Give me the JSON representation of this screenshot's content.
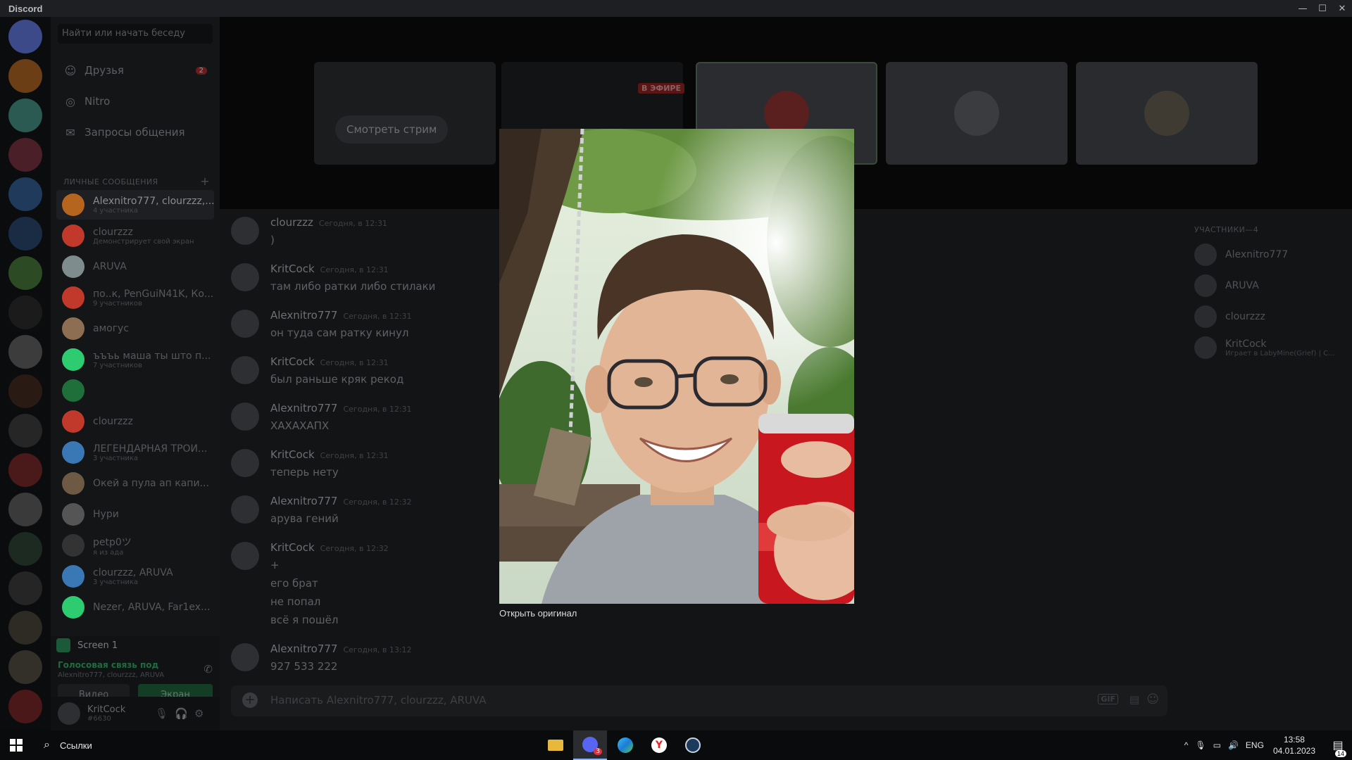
{
  "window": {
    "title": "Discord",
    "controls": [
      "—",
      "☐",
      "✕"
    ]
  },
  "dm_panel": {
    "search_placeholder": "Найти или начать беседу",
    "nav": [
      {
        "label": "Друзья",
        "icon": "friends-icon",
        "count": "2"
      },
      {
        "label": "Nitro",
        "icon": "nitro-icon"
      },
      {
        "label": "Запросы общения",
        "icon": "mail-icon"
      }
    ],
    "section_title": "ЛИЧНЫЕ СООБЩЕНИЯ",
    "section_add": "+",
    "dms": [
      {
        "name": "Alexnitro777, clourzzz,...",
        "sub": "4 участника",
        "color": "#b5651d",
        "active": true
      },
      {
        "name": "clourzzz",
        "sub": "Демонстрирует свой экран",
        "color": "#c0392b"
      },
      {
        "name": "ARUVA",
        "sub": "",
        "color": "#7f8c8d"
      },
      {
        "name": "по..к, PenGuiN41K, Ко...",
        "sub": "9 участников",
        "color": "#c0392b"
      },
      {
        "name": "амогус",
        "sub": "",
        "color": "#8e6e53"
      },
      {
        "name": "ъъъь маша ты што п...",
        "sub": "7 участников",
        "color": "#2ecc71"
      },
      {
        "name": "",
        "sub": "",
        "color": "#1f6f3a"
      },
      {
        "name": "clourzzz",
        "sub": "",
        "color": "#c0392b"
      },
      {
        "name": "ЛЕГЕНДАРНАЯ ТРОИ...",
        "sub": "3 участника",
        "color": "#3a78b5"
      },
      {
        "name": "Окей а пула ап капи...",
        "sub": "",
        "color": "#6e5a44"
      },
      {
        "name": "Нури",
        "sub": "",
        "color": "#555"
      },
      {
        "name": "petp0ツ",
        "sub": "я из ада",
        "color": "#333"
      },
      {
        "name": "clourzzz, ARUVA",
        "sub": "3 участника",
        "color": "#3a78b5"
      },
      {
        "name": "Nezer, ARUVA, Far1ex...",
        "sub": "",
        "color": "#2ecc71"
      }
    ],
    "screen_share": "Screen 1",
    "voice_status": "Голосовая связь под",
    "voice_members": "Alexnitro777, clourzzz, ARUVA",
    "video_label": "Видео",
    "screen_label": "Экран",
    "user_name": "KritCock",
    "user_tag": "#6630"
  },
  "stream": {
    "watch_label": "Смотреть стрим",
    "live_label": "В ЭФИРЕ"
  },
  "messages": [
    {
      "author": "clourzzz",
      "time": "Сегодня, в 12:31",
      "lines": [
        ")"
      ]
    },
    {
      "author": "KritCock",
      "time": "Сегодня, в 12:31",
      "lines": [
        "там либо ратки либо стилаки"
      ]
    },
    {
      "author": "Alexnitro777",
      "time": "Сегодня, в 12:31",
      "lines": [
        "он туда сам ратку кинул"
      ]
    },
    {
      "author": "KritCock",
      "time": "Сегодня, в 12:31",
      "lines": [
        "был раньше кряк рекод"
      ]
    },
    {
      "author": "Alexnitro777",
      "time": "Сегодня, в 12:31",
      "lines": [
        "ХАХАХАПХ"
      ]
    },
    {
      "author": "KritCock",
      "time": "Сегодня, в 12:31",
      "lines": [
        "теперь нету"
      ]
    },
    {
      "author": "Alexnitro777",
      "time": "Сегодня, в 12:32",
      "lines": [
        "арува гений"
      ]
    },
    {
      "author": "KritCock",
      "time": "Сегодня, в 12:32",
      "lines": [
        "+",
        "его брат",
        "не попал",
        "всё я пошёл"
      ]
    },
    {
      "author": "Alexnitro777",
      "time": "Сегодня, в 13:12",
      "lines": [
        "927 533 222"
      ]
    }
  ],
  "composer": {
    "placeholder": "Написать Alexnitro777, clourzzz, ARUVA",
    "gif_label": "GIF"
  },
  "members": {
    "title": "УЧАСТНИКИ—4",
    "list": [
      {
        "name": "Alexnitro777",
        "sub": ""
      },
      {
        "name": "ARUVA",
        "sub": ""
      },
      {
        "name": "clourzzz",
        "sub": ""
      },
      {
        "name": "KritCock",
        "sub": "Играет в LabyMine(Grief) | C..."
      }
    ]
  },
  "modal": {
    "open_original": "Открыть оригинал"
  },
  "taskbar": {
    "search_label": "Ссылки",
    "discord_badge": "3",
    "lang": "ENG",
    "time": "13:58",
    "date": "04.01.2023",
    "notif_count": "14"
  }
}
